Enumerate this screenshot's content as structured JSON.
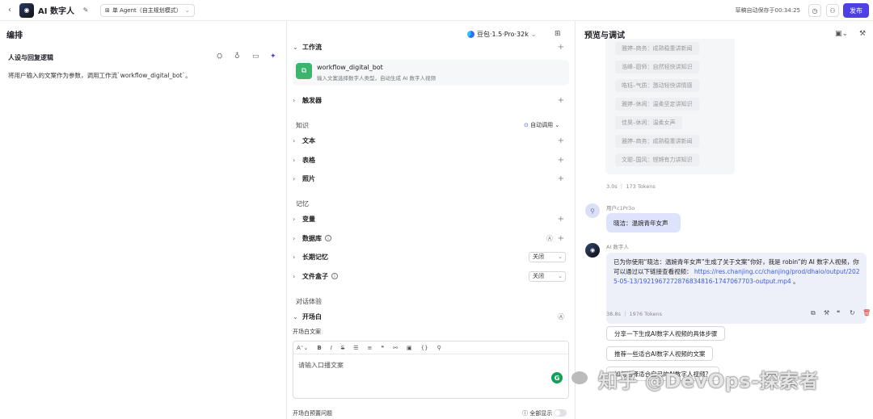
{
  "topbar": {
    "bot_name": "AI 数字人",
    "agent_mode": "单 Agent（自主规划模式）",
    "autosave": "草稿自动保存于00:34:25",
    "publish": "发布"
  },
  "left": {
    "panel_title": "编排",
    "section_title": "人设与回复逻辑",
    "prompt": "将用户输入的文案作为参数，调用工作流`workflow_digital_bot`。"
  },
  "mid": {
    "model": "豆包·1.5·Pro·32k",
    "workflow_section": "工作流",
    "workflow_name": "workflow_digital_bot",
    "workflow_desc": "输入文案选择数字人类型，自动生成 AI 数字人视频",
    "trigger": "触发器",
    "knowledge": "知识",
    "auto_call": "自动调用",
    "text": "文本",
    "table": "表格",
    "photo": "照片",
    "memory": "记忆",
    "variable": "变量",
    "database": "数据库",
    "long_memory": "长期记忆",
    "long_memory_value": "关闭",
    "filebox": "文件盒子",
    "filebox_value": "关闭",
    "dialog_exp": "对话体验",
    "opening": "开场白",
    "opening_text_label": "开场白文案",
    "editor_placeholder": "请输入口播文案",
    "opening_questions": "开场白预置问题",
    "show_all": "全部显示"
  },
  "right": {
    "panel_title": "预览与调试",
    "voice_options": [
      "雅婷–商务：成熟稳重讲新闻",
      "浩峰–厨师：自然轻快讲知识",
      "皓钰–气质：激动轻快讲情感",
      "雅婷–休闲：温柔坚定讲知识",
      "佳昊–休闲：温柔女声",
      "雅婷–商务：成熟稳重讲新闻",
      "文聪–国风：铿锵有力讲知识"
    ],
    "meta1": "3.0s ｜ 173 Tokens",
    "user_name": "用户c1Pr3o",
    "user_msg": "晓洁：温婉青年女声",
    "bot_name": "AI 数字人",
    "bot_msg": "已为你使用“晓洁：温婉青年女声”生成了关于文案“你好，我是 robin”的 AI 数字人视频，你可以通过以下链接查看视频：",
    "bot_link": "https://res.chanjing.cc/chanjing/prod/dhaio/output/2025-05-13/1921967272876834816-1747067703-output.mp4",
    "bot_tail": "。",
    "meta2": "38.8s ｜ 1976 Tokens",
    "suggestions": [
      "分享一下生成AI数字人视频的具体步骤",
      "推荐一些适合AI数字人视频的文案",
      "如何选择适合自己的AI数字人视频？"
    ]
  },
  "watermark": "知乎 @DevOps-探索者"
}
